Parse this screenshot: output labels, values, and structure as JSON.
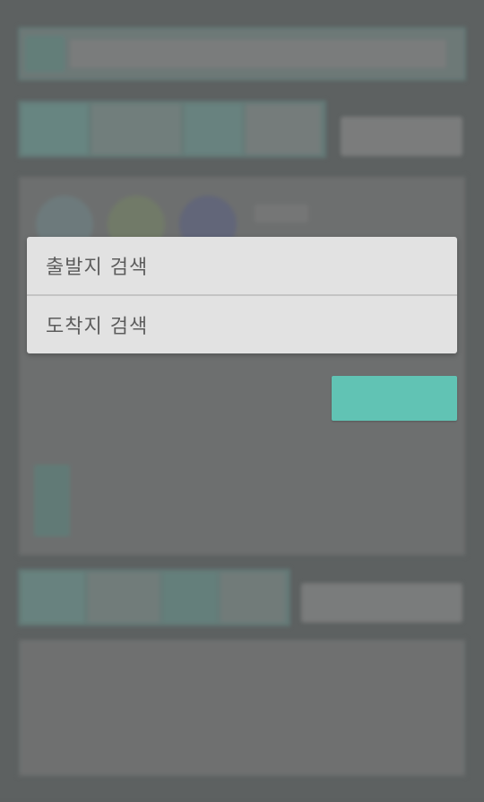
{
  "dialog": {
    "items": [
      {
        "label": "출발지 검색"
      },
      {
        "label": "도착지 검색"
      }
    ]
  },
  "colors": {
    "accent": "#61c3b4",
    "dialog_bg": "#e2e2e2",
    "scrim": "#5f6363"
  },
  "icons": {
    "search": "search-icon",
    "dropdown": "chevron-down-icon"
  }
}
